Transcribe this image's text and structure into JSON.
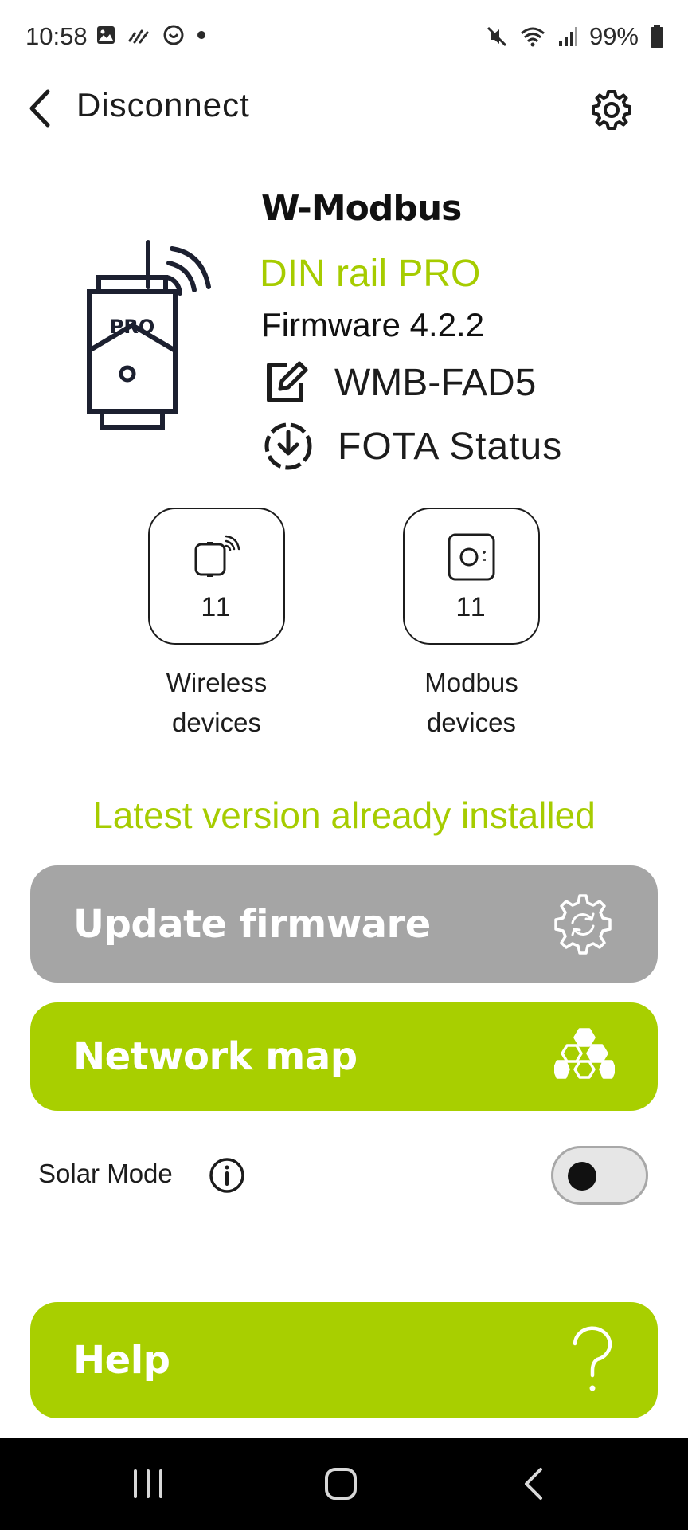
{
  "status_bar": {
    "time": "10:58",
    "battery": "99%",
    "left_icons": [
      "image-icon",
      "motion-icon",
      "activity-icon",
      "dot-icon"
    ],
    "right_icons": [
      "mute-icon",
      "wifi-icon",
      "signal-icon",
      "battery-icon"
    ]
  },
  "header": {
    "back_label": "Disconnect"
  },
  "device": {
    "brand": "W-Modbus",
    "model": "DIN rail PRO",
    "firmware": "Firmware 4.2.2",
    "name": "WMB-FAD5",
    "fota_label": "FOTA Status",
    "badge": "PRO"
  },
  "tiles": [
    {
      "count": "11",
      "label_line1": "Wireless",
      "label_line2": "devices"
    },
    {
      "count": "11",
      "label_line1": "Modbus",
      "label_line2": "devices"
    }
  ],
  "update_status": "Latest version already installed",
  "buttons": {
    "update_firmware": "Update firmware",
    "network_map": "Network map",
    "help": "Help"
  },
  "solar_mode": {
    "label": "Solar Mode",
    "enabled": false
  },
  "colors": {
    "accent": "#a8cf00",
    "disabled": "#a5a5a5",
    "text": "#1c1c1c"
  }
}
